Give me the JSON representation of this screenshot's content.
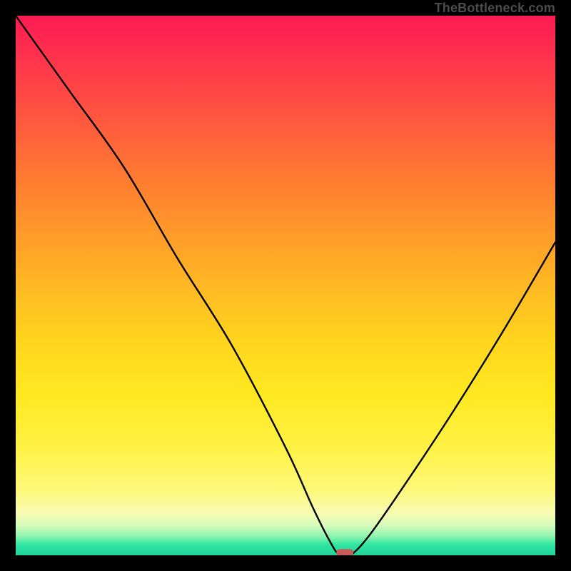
{
  "watermark": "TheBottleneck.com",
  "chart_data": {
    "type": "line",
    "title": "",
    "xlabel": "",
    "ylabel": "",
    "xlim": [
      0,
      100
    ],
    "ylim": [
      0,
      100
    ],
    "series": [
      {
        "name": "bottleneck-curve",
        "x": [
          0,
          10,
          20,
          30,
          40,
          50,
          55,
          58,
          60,
          62,
          65,
          70,
          80,
          90,
          100
        ],
        "values": [
          100,
          86,
          72,
          55,
          39,
          20,
          9,
          3,
          0,
          0,
          3,
          10,
          25,
          41,
          58
        ]
      }
    ],
    "marker": {
      "x": 61,
      "y": 0.5,
      "color": "#c95b5b"
    },
    "gradient_stops": [
      {
        "pos": 0,
        "color": "#ff1a54"
      },
      {
        "pos": 50,
        "color": "#ffd41e"
      },
      {
        "pos": 92,
        "color": "#f9fbb0"
      },
      {
        "pos": 100,
        "color": "#22d39a"
      }
    ]
  }
}
